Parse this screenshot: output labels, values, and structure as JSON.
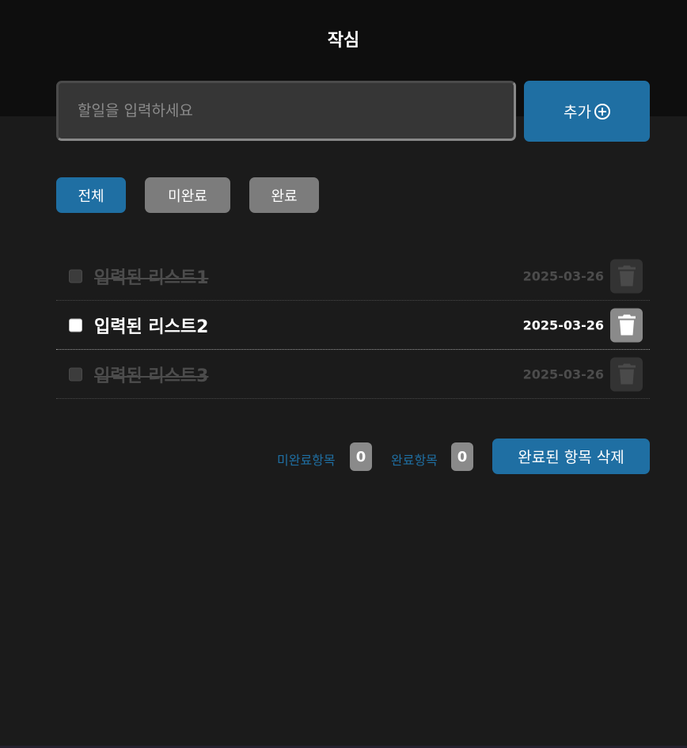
{
  "header": {
    "title": "작심"
  },
  "input": {
    "placeholder": "할일을 입력하세요",
    "value": ""
  },
  "add_button": {
    "label": "추가",
    "icon": "plus-circle-icon"
  },
  "filters": [
    {
      "label": "전체",
      "active": true
    },
    {
      "label": "미완료",
      "active": false
    },
    {
      "label": "완료",
      "active": false
    }
  ],
  "todos": [
    {
      "text": "입력된 리스트1",
      "date": "2025-03-26",
      "done": true
    },
    {
      "text": "입력된 리스트2",
      "date": "2025-03-26",
      "done": false
    },
    {
      "text": "입력된 리스트3",
      "date": "2025-03-26",
      "done": true
    }
  ],
  "footer": {
    "incomplete_label": "미완료항목",
    "incomplete_count": "0",
    "complete_label": "완료항목",
    "complete_count": "0",
    "clear_label": "완료된 항목 삭제"
  },
  "colors": {
    "accent": "#1f6fa3",
    "background": "#1b1b1b",
    "header_bg": "#0e0e0e",
    "muted": "#7c7c7c"
  }
}
